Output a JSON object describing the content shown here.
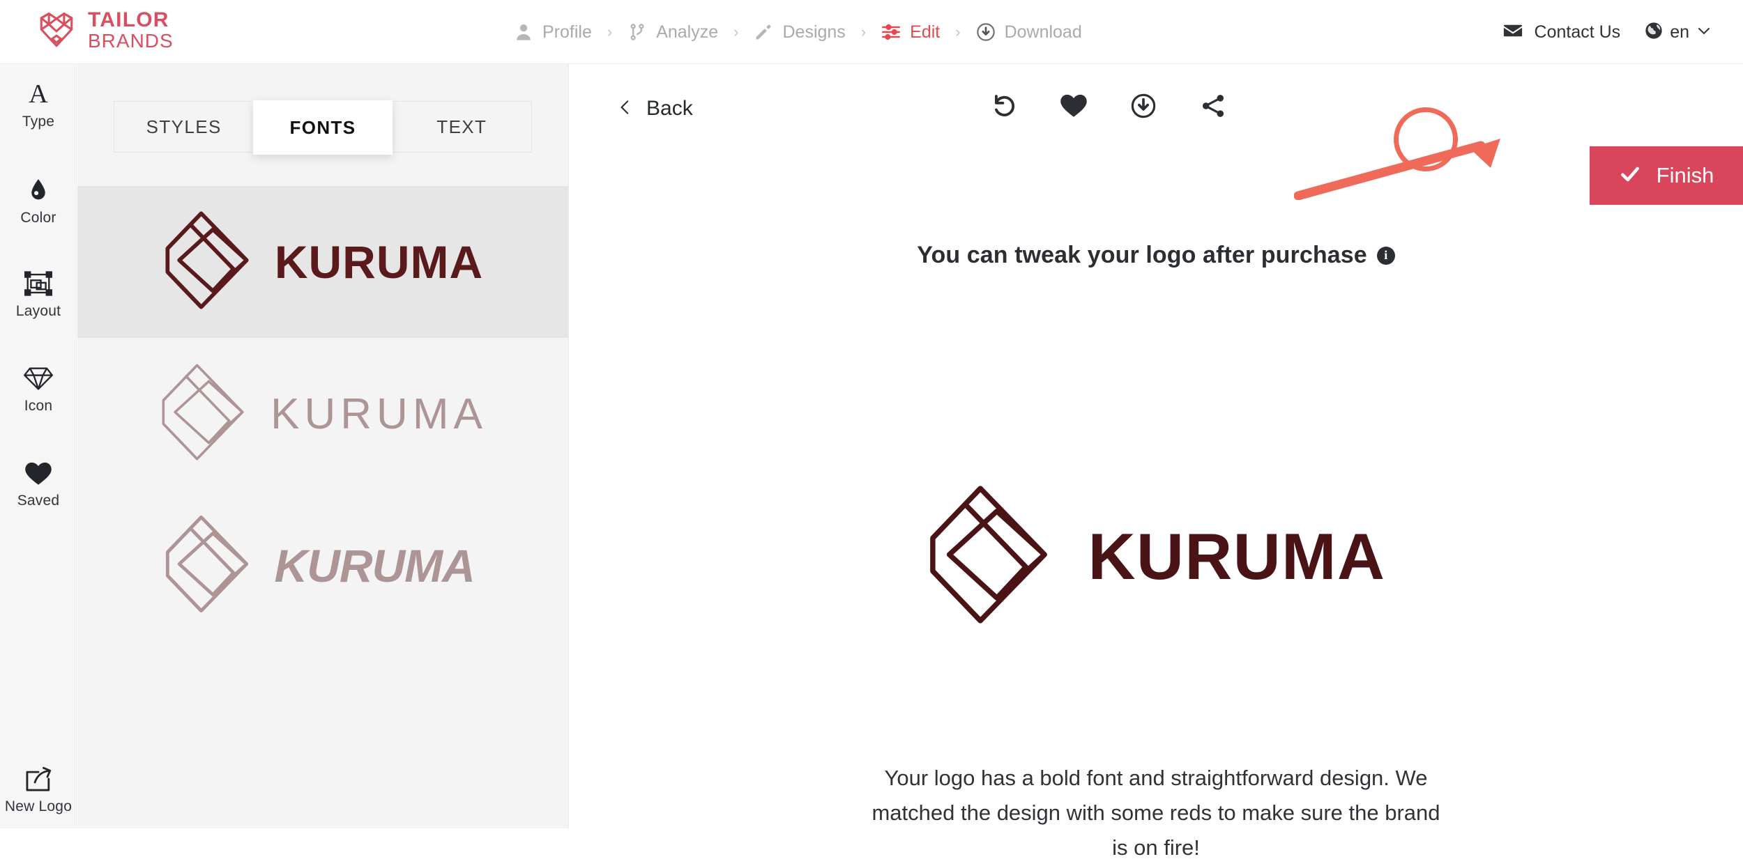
{
  "brand": {
    "line1": "TAILOR",
    "line2": "BRANDS",
    "color": "#D8505F",
    "mark_icon": "tailor-brands-heart-shield-icon"
  },
  "header": {
    "steps": [
      {
        "label": "Profile",
        "icon": "person-icon",
        "active": false
      },
      {
        "label": "Analyze",
        "icon": "branch-icon",
        "active": false
      },
      {
        "label": "Designs",
        "icon": "pencil-icon",
        "active": false
      },
      {
        "label": "Edit",
        "icon": "sliders-icon",
        "active": true
      },
      {
        "label": "Download",
        "icon": "download-circle-icon",
        "active": false
      }
    ],
    "separator": "›",
    "active_color": "#E8474F",
    "inactive_color": "#A8ABAE",
    "contact": {
      "label": "Contact Us",
      "icon": "envelope-icon"
    },
    "language": {
      "label": "en",
      "icon": "globe-icon",
      "chevron": "chevron-down-icon"
    }
  },
  "rail": {
    "items": [
      {
        "label": "Type",
        "icon": "serif-a-icon"
      },
      {
        "label": "Color",
        "icon": "droplet-icon"
      },
      {
        "label": "Layout",
        "icon": "transform-box-icon"
      },
      {
        "label": "Icon",
        "icon": "gem-icon"
      },
      {
        "label": "Saved",
        "icon": "heart-icon"
      }
    ],
    "bottom": {
      "label": "New Logo",
      "icon": "new-window-arrow-icon"
    }
  },
  "panel": {
    "tabs": [
      {
        "label": "STYLES",
        "active": false
      },
      {
        "label": "FONTS",
        "active": true
      },
      {
        "label": "TEXT",
        "active": false
      }
    ],
    "variants": [
      {
        "text": "KURUMA",
        "style": "bold",
        "color": "#5A1A1C",
        "selected": true
      },
      {
        "text": "KURUMA",
        "style": "thin",
        "color": "#AE9595",
        "selected": false
      },
      {
        "text": "KURUMA",
        "style": "condensed",
        "color": "#AE9595",
        "selected": false
      }
    ]
  },
  "canvas": {
    "back": {
      "label": "Back",
      "icon": "chevron-left-icon"
    },
    "tools": [
      {
        "name": "undo",
        "icon": "undo-arrow-icon"
      },
      {
        "name": "favorite",
        "icon": "heart-filled-icon"
      },
      {
        "name": "download",
        "icon": "download-circle-icon",
        "highlighted": true
      },
      {
        "name": "share",
        "icon": "share-nodes-icon"
      }
    ],
    "tweak_message": "You can tweak your logo after purchase",
    "tweak_info_icon": "info-icon",
    "logo": {
      "text": "KURUMA",
      "color": "#4A1315",
      "icon": "interlocking-diamond-icon"
    },
    "description": "Your logo has a bold font and straightforward design. We matched the design with some reds to make sure the brand is on fire!",
    "finish": {
      "label": "Finish",
      "icon": "check-icon",
      "color": "#D9455A"
    },
    "annotation_color": "#F06A5A"
  }
}
